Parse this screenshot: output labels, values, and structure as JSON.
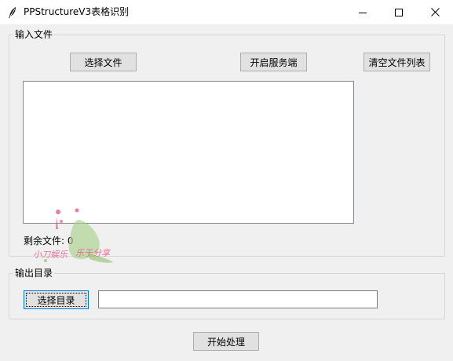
{
  "window": {
    "title": "PPStructureV3表格识别",
    "icon": "feather-icon",
    "controls": {
      "minimize": "minimize-icon",
      "maximize": "maximize-icon",
      "close": "close-icon"
    }
  },
  "input_section": {
    "label": "输入文件",
    "select_files_label": "选择文件",
    "start_service_label": "开启服务端",
    "clear_list_label": "清空文件列表",
    "files": [],
    "remaining_text": "剩余文件: 0"
  },
  "output_section": {
    "label": "输出目录",
    "select_dir_label": "选择目录",
    "dir_value": ""
  },
  "start_label": "开始处理",
  "watermark": {
    "text": "小刀娱乐 乐于分享",
    "colors": [
      "#e85a8a",
      "#8fbf6a"
    ]
  }
}
